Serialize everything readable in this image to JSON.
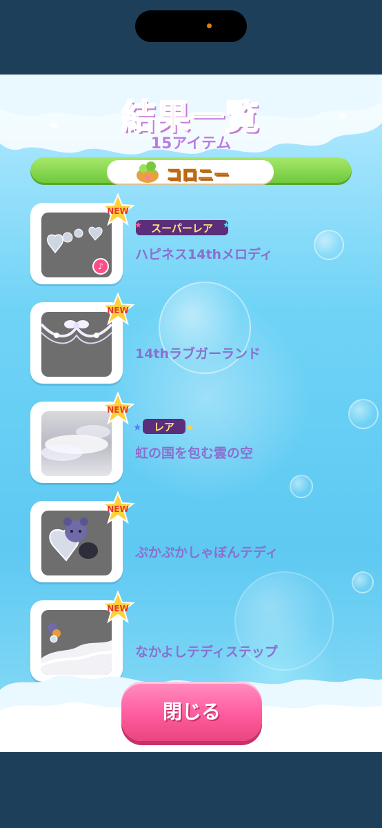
{
  "header": {
    "title": "結果一覧",
    "subtitle": "15アイテム"
  },
  "category": {
    "label": "コロニー",
    "icon": "colony-icon"
  },
  "new_label": "NEW",
  "items": [
    {
      "name": "ハピネス14thメロディ",
      "rarity": "スーパーレア",
      "new": true,
      "has_music": true
    },
    {
      "name": "14thラブガーランド",
      "rarity": "",
      "new": true
    },
    {
      "name": "虹の国を包む雲の空",
      "rarity": "レア",
      "new": true
    },
    {
      "name": "ぷかぷかしゃぼんテディ",
      "rarity": "",
      "new": true
    },
    {
      "name": "なかよしテディステップ",
      "rarity": "",
      "new": true
    }
  ],
  "close_button": {
    "label": "閉じる"
  },
  "colors": {
    "name_text": "#8a6fcf",
    "title_pink": "#ff7a9c",
    "button_pink": "#ff5c9e",
    "bar_green": "#6cc63a"
  }
}
